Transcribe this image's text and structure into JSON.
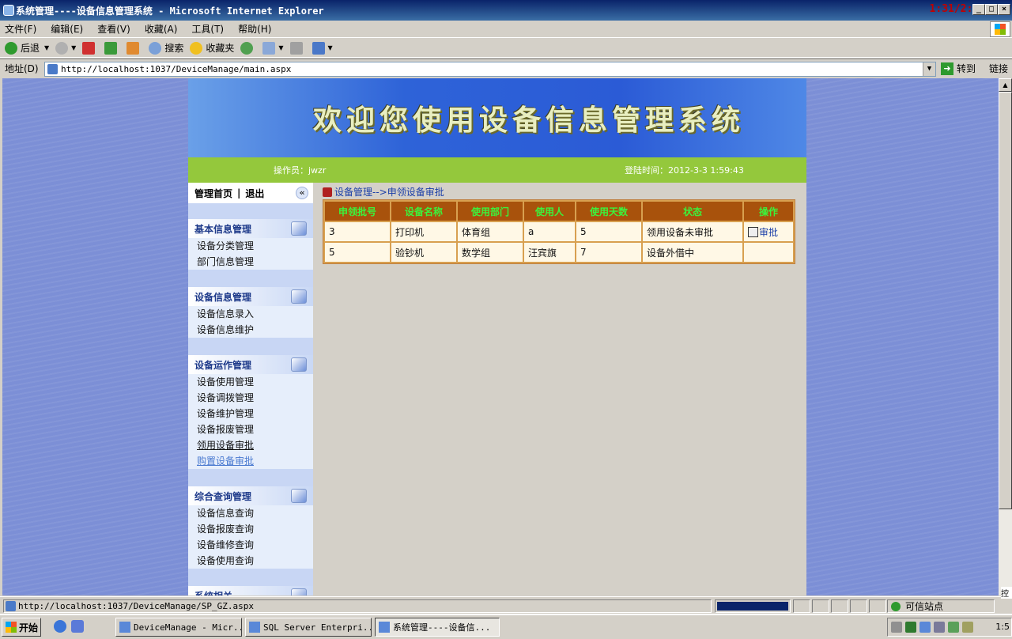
{
  "window": {
    "title": "系统管理----设备信息管理系统 - Microsoft Internet Explorer",
    "clock": "1:31/2:46"
  },
  "menu": [
    "文件(F)",
    "编辑(E)",
    "查看(V)",
    "收藏(A)",
    "工具(T)",
    "帮助(H)"
  ],
  "toolbar": {
    "back": "后退",
    "search": "搜索",
    "favorites": "收藏夹"
  },
  "address": {
    "label": "地址(D)",
    "url": "http://localhost:1037/DeviceManage/main.aspx",
    "go": "转到",
    "links": "链接"
  },
  "page": {
    "banner": "欢迎您使用设备信息管理系统",
    "operator": "操作员：jwzr",
    "login_time": "登陆时间：2012-3-3 1:59:43",
    "sidebar": {
      "home": "管理首页",
      "sep": "|",
      "logout": "退出",
      "sections": [
        {
          "title": "基本信息管理",
          "items": [
            "设备分类管理",
            "部门信息管理"
          ]
        },
        {
          "title": "设备信息管理",
          "items": [
            "设备信息录入",
            "设备信息维护"
          ]
        },
        {
          "title": "设备运作管理",
          "items": [
            "设备使用管理",
            "设备调拨管理",
            "设备维护管理",
            "设备报废管理",
            "领用设备审批",
            "购置设备审批"
          ]
        },
        {
          "title": "综合查询管理",
          "items": [
            "设备信息查询",
            "设备报废查询",
            "设备维修查询",
            "设备使用查询"
          ]
        },
        {
          "title": "系统相关",
          "items": []
        }
      ]
    },
    "breadcrumb": "设备管理-->申领设备审批",
    "table": {
      "headers": [
        "申领批号",
        "设备名称",
        "使用部门",
        "使用人",
        "使用天数",
        "状态",
        "操作"
      ],
      "rows": [
        [
          "3",
          "打印机",
          "体育组",
          "a",
          "5",
          "领用设备未审批",
          "审批"
        ],
        [
          "5",
          "验钞机",
          "数学组",
          "汪宾旗",
          "7",
          "设备外借中",
          ""
        ]
      ]
    }
  },
  "status": {
    "url": "http://localhost:1037/DeviceManage/SP_GZ.aspx",
    "zone": "可信站点"
  },
  "taskbar": {
    "start": "开始",
    "tasks": [
      "DeviceManage - Micr...",
      "SQL Server Enterpri...",
      "系统管理----设备信..."
    ],
    "time": "1:5",
    "side": "控"
  },
  "colors": {
    "header_bg": "#a8520c",
    "header_text": "#3cf23c",
    "green_bar": "#94c83c",
    "page_bg": "#7c8fd6"
  }
}
